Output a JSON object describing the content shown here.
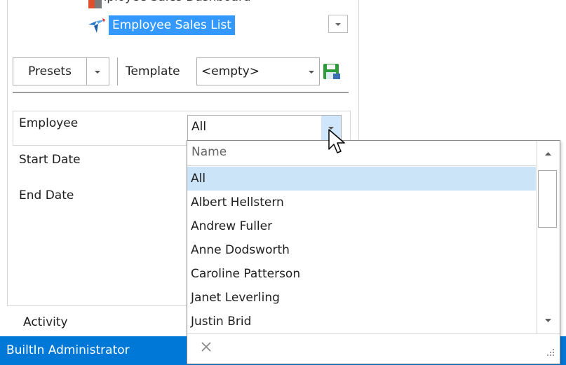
{
  "tree": {
    "prev_item": "Employee Sales Dashboard",
    "selected_item": "Employee Sales List"
  },
  "toolbar": {
    "presets_label": "Presets",
    "template_label": "Template",
    "template_value": "<empty>"
  },
  "params": {
    "employee_label": "Employee",
    "employee_value": "All",
    "start_date_label": "Start Date",
    "end_date_label": "End Date"
  },
  "popup": {
    "header": "Name",
    "items": [
      "All",
      "Albert Hellstern",
      "Andrew Fuller",
      "Anne Dodsworth",
      "Caroline Patterson",
      "Janet Leverling",
      "Justin Brid"
    ],
    "selected_index": 0
  },
  "activity_label": "Activity",
  "status": {
    "user": "BuiltIn Administrator"
  },
  "colors": {
    "selection": "#3399ff",
    "status_bar": "#0078d7",
    "row_highlight": "#cce4f7",
    "save_icon": "#2e9c3a"
  }
}
